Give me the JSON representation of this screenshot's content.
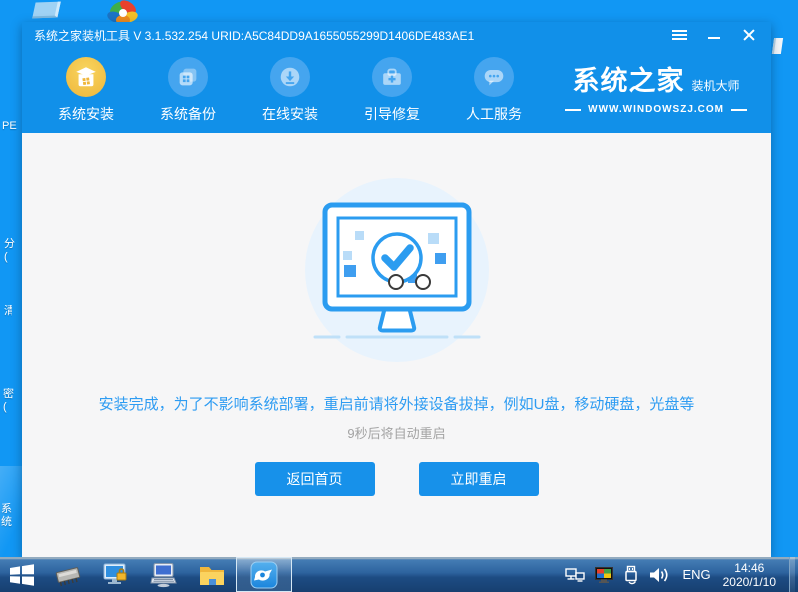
{
  "desktop": {
    "fragments": [
      {
        "label": "PE"
      },
      {
        "label": "分\n("
      },
      {
        "label": "清"
      },
      {
        "label": "密\n("
      },
      {
        "label": "系统"
      }
    ]
  },
  "window": {
    "title": "系统之家装机工具 V 3.1.532.254 URID:A5C84DD9A1655055299D1406DE483AE1",
    "nav": {
      "items": [
        {
          "label": "系统安装",
          "active": true
        },
        {
          "label": "系统备份",
          "active": false
        },
        {
          "label": "在线安装",
          "active": false
        },
        {
          "label": "引导修复",
          "active": false
        },
        {
          "label": "人工服务",
          "active": false
        }
      ]
    },
    "logo": {
      "brand": "系统之家",
      "sub": "装机大师",
      "site": "WWW.WINDOWSZJ.COM"
    },
    "main": {
      "message": "安装完成，为了不影响系统部署，重启前请将外接设备拔掉，例如U盘，移动硬盘，光盘等",
      "countdown": "9秒后将自动重启",
      "buttons": [
        {
          "label": "返回首页"
        },
        {
          "label": "立即重启"
        }
      ]
    }
  },
  "taskbar": {
    "tray": {
      "language": "ENG",
      "time": "14:46",
      "date": "2020/1/10"
    }
  },
  "colors": {
    "desktop_blue": "#1197f4",
    "header_blue": "#1190e9",
    "accent_blue": "#2e9cf2",
    "button_blue": "#1791ea",
    "active_gold": "#efb63a",
    "content_bg": "#f6f6f7"
  }
}
